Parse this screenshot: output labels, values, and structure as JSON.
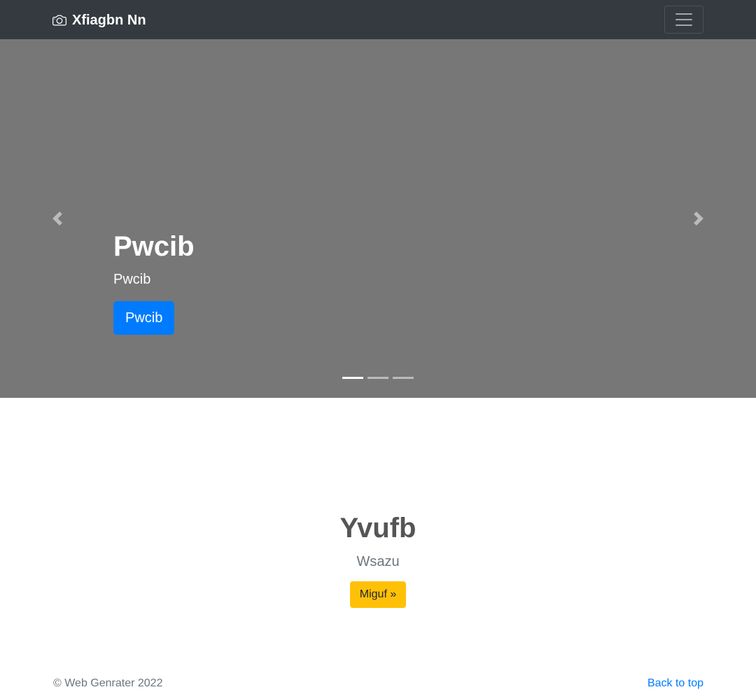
{
  "navbar": {
    "brand": "Xfiagbn Nn",
    "brand_icon": "camera-icon",
    "toggler_icon": "hamburger-menu-icon"
  },
  "carousel": {
    "background": "#777777",
    "slides_count": 3,
    "active_slide": 1,
    "caption": {
      "title": "Pwcib",
      "text": "Pwcib",
      "button": "Pwcib"
    },
    "prev_icon": "chevron-left-icon",
    "next_icon": "chevron-right-icon"
  },
  "hero": {
    "title": "Yvufb",
    "lead": "Wsazu",
    "button": "Miguf »"
  },
  "footer": {
    "copyright": "© Web Genrater 2022",
    "back_to_top": "Back to top"
  },
  "colors": {
    "navbar": "#343a40",
    "primary": "#007bff",
    "warning": "#ffc107"
  }
}
